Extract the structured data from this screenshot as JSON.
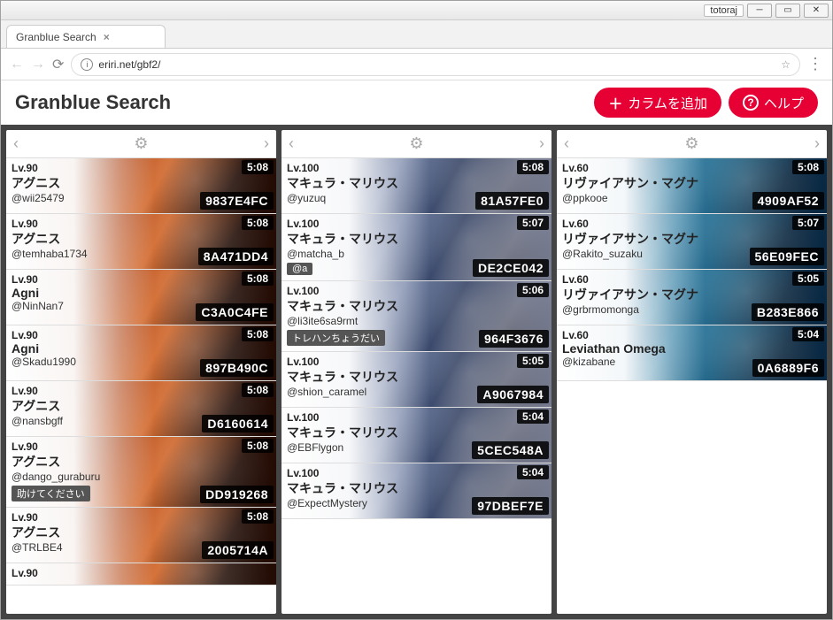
{
  "window": {
    "app_label": "totoraj",
    "tab_title": "Granblue Search",
    "url": "eriri.net/gbf2/"
  },
  "header": {
    "title": "Granblue Search",
    "add_column": "カラムを追加",
    "help": "ヘルプ"
  },
  "columns": [
    {
      "bg": "bg1",
      "cards": [
        {
          "level": "Lv.90",
          "name": "アグニス",
          "handle": "@wii25479",
          "time": "5:08",
          "code": "9837E4FC"
        },
        {
          "level": "Lv.90",
          "name": "アグニス",
          "handle": "@temhaba1734",
          "time": "5:08",
          "code": "8A471DD4"
        },
        {
          "level": "Lv.90",
          "name": "Agni",
          "handle": "@NinNan7",
          "time": "5:08",
          "code": "C3A0C4FE"
        },
        {
          "level": "Lv.90",
          "name": "Agni",
          "handle": "@Skadu1990",
          "time": "5:08",
          "code": "897B490C"
        },
        {
          "level": "Lv.90",
          "name": "アグニス",
          "handle": "@nansbgff",
          "time": "5:08",
          "code": "D6160614"
        },
        {
          "level": "Lv.90",
          "name": "アグニス",
          "handle": "@dango_guraburu",
          "time": "5:08",
          "code": "DD919268",
          "chip": "助けてください"
        },
        {
          "level": "Lv.90",
          "name": "アグニス",
          "handle": "@TRLBE4",
          "time": "5:08",
          "code": "2005714A"
        },
        {
          "level": "Lv.90",
          "name": "",
          "handle": "",
          "time": "",
          "code": "",
          "cut": true
        }
      ]
    },
    {
      "bg": "bg2",
      "cards": [
        {
          "level": "Lv.100",
          "name": "マキュラ・マリウス",
          "handle": "@yuzuq",
          "time": "5:08",
          "code": "81A57FE0"
        },
        {
          "level": "Lv.100",
          "name": "マキュラ・マリウス",
          "handle": "@matcha_b",
          "time": "5:07",
          "code": "DE2CE042",
          "chip": "@a"
        },
        {
          "level": "Lv.100",
          "name": "マキュラ・マリウス",
          "handle": "@li3ite6sa9rmt",
          "time": "5:06",
          "code": "964F3676",
          "chip": "トレハンちょうだい"
        },
        {
          "level": "Lv.100",
          "name": "マキュラ・マリウス",
          "handle": "@shion_caramel",
          "time": "5:05",
          "code": "A9067984"
        },
        {
          "level": "Lv.100",
          "name": "マキュラ・マリウス",
          "handle": "@EBFlygon",
          "time": "5:04",
          "code": "5CEC548A"
        },
        {
          "level": "Lv.100",
          "name": "マキュラ・マリウス",
          "handle": "@ExpectMystery",
          "time": "5:04",
          "code": "97DBEF7E"
        }
      ]
    },
    {
      "bg": "bg3",
      "cards": [
        {
          "level": "Lv.60",
          "name": "リヴァイアサン・マグナ",
          "handle": "@ppkooe",
          "time": "5:08",
          "code": "4909AF52"
        },
        {
          "level": "Lv.60",
          "name": "リヴァイアサン・マグナ",
          "handle": "@Rakito_suzaku",
          "time": "5:07",
          "code": "56E09FEC"
        },
        {
          "level": "Lv.60",
          "name": "リヴァイアサン・マグナ",
          "handle": "@grbrmomonga",
          "time": "5:05",
          "code": "B283E866"
        },
        {
          "level": "Lv.60",
          "name": "Leviathan Omega",
          "handle": "@kizabane",
          "time": "5:04",
          "code": "0A6889F6"
        }
      ]
    }
  ]
}
